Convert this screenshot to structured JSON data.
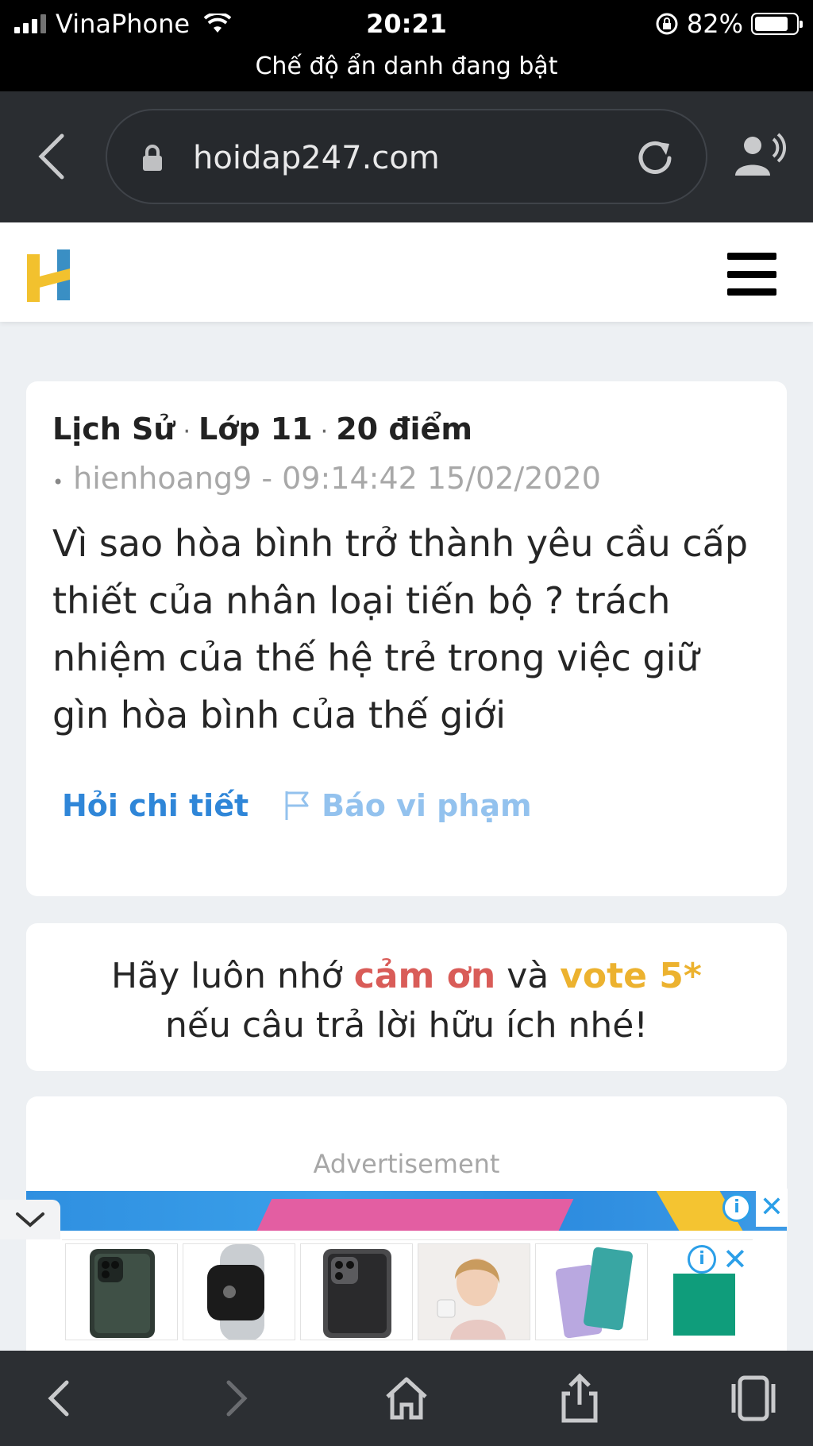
{
  "status_bar": {
    "carrier": "VinaPhone",
    "time": "20:21",
    "battery": "82%",
    "battery_level": 0.82,
    "incognito_text": "Chế độ ẩn danh đang bật"
  },
  "browser": {
    "url": "hoidap247.com"
  },
  "question": {
    "subject": "Lịch Sử",
    "grade": "Lớp 11",
    "points": "20 điểm",
    "author_line": "hienhoang9 - 09:14:42 15/02/2020",
    "text": "Vì sao hòa bình trở thành yêu cầu cấp thiết của nhân loại tiến bộ ? trách nhiệm của thế hệ trẻ trong việc giữ gìn hòa bình của thế giới",
    "ask_detail": "Hỏi chi tiết",
    "report": "Báo vi phạm"
  },
  "reminder": {
    "part1": "Hãy luôn nhớ ",
    "thanks": "cảm ơn",
    "part2": " và ",
    "vote": "vote 5*",
    "line2": "nếu câu trả lời hữu ích nhé!"
  },
  "ad": {
    "label": "Advertisement",
    "info_glyph": "i",
    "close_glyph": "✕"
  },
  "colors": {
    "link_blue": "#2f86d8",
    "report_blue": "#93c2ee",
    "thanks_red": "#d95c58",
    "vote_gold": "#ecb22f",
    "toolbar_bg": "#2c2f33",
    "logo_yellow": "#f2c12e",
    "logo_blue": "#3a8fc4"
  },
  "icons": [
    "back-icon",
    "lock-icon",
    "reload-icon",
    "voice-icon",
    "menu-icon",
    "flag-icon",
    "chevron-down-icon",
    "forward-icon",
    "home-icon",
    "share-icon",
    "tabs-icon"
  ]
}
